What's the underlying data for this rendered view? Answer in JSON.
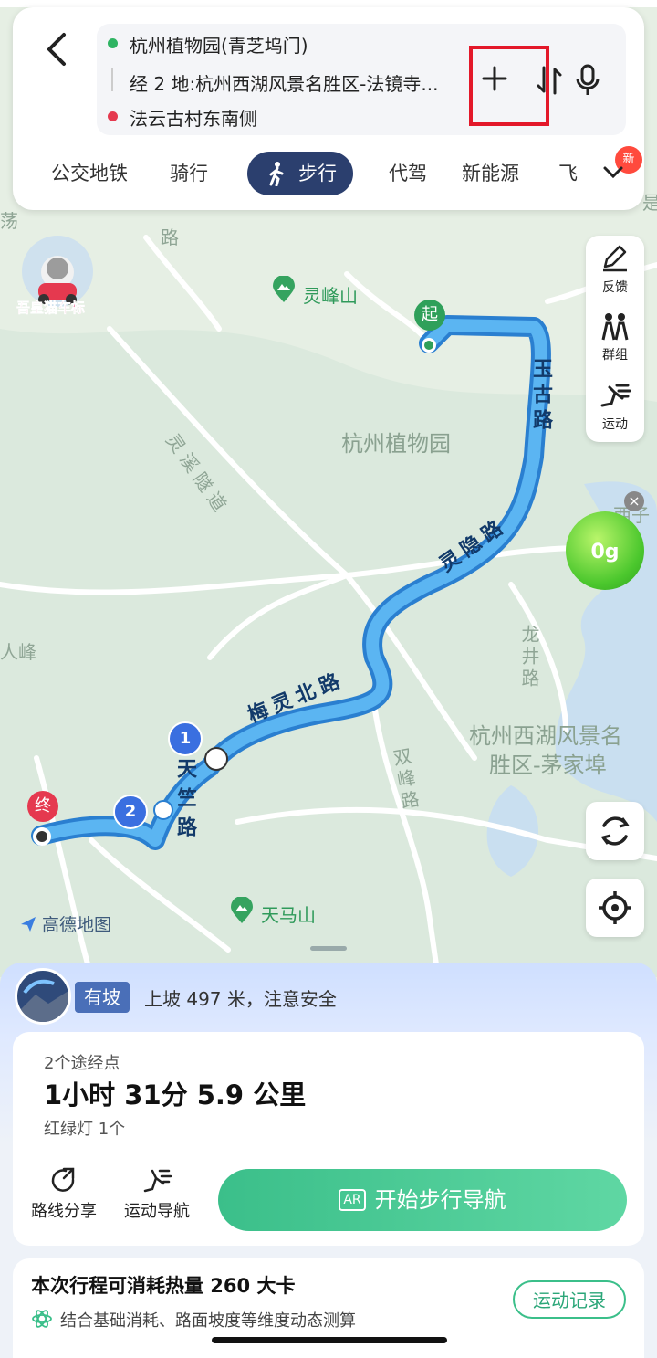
{
  "colors": {
    "accent": "#2b3f6e",
    "route": "#4aa3e8",
    "start": "#2fa05a",
    "end": "#e5394f",
    "go": "#3bbf8a",
    "highlight": "#e3182a"
  },
  "header": {
    "back_icon": "chevron-left-icon",
    "origin": "杭州植物园(青芝坞门)",
    "via": "经 2 地:杭州西湖风景名胜区-法镜寺...",
    "destination": "法云古村东南侧",
    "add_icon": "plus-icon",
    "swap_icon": "swap-icon",
    "mic_icon": "mic-icon"
  },
  "tabs": [
    {
      "label": "公交地铁"
    },
    {
      "label": "骑行"
    },
    {
      "label": "步行",
      "active": true
    },
    {
      "label": "代驾"
    },
    {
      "label": "新能源"
    },
    {
      "label": "飞"
    }
  ],
  "new_badge": "新",
  "tools": [
    {
      "label": "反馈",
      "icon": "pencil-icon"
    },
    {
      "label": "群组",
      "icon": "group-icon"
    },
    {
      "label": "运动",
      "icon": "running-icon"
    }
  ],
  "map": {
    "labels": {
      "lingfeng": "灵峰山",
      "botanical": "杭州植物园",
      "tianma": "天马山",
      "maojiabu_1": "杭州西湖风景名",
      "maojiabu_2": "胜区-茅家埠",
      "lingxi": "灵溪隧道",
      "longjing": "龙井路",
      "shuangfeng": "双峰路",
      "renfeng": "人峰",
      "yugu": "玉古路",
      "lingyin": "灵隐路",
      "meiling": "梅灵北路",
      "tianzhu": "天竺路",
      "xizi": "西子",
      "top_left": "荡",
      "top_right": "是",
      "luroad": "路"
    },
    "start_marker": "起",
    "end_marker": "终",
    "waypoint_1": "1",
    "waypoint_2": "2",
    "green_ball": "0g",
    "avatar_tag": "吾皇猫车标",
    "logo": "高德地图"
  },
  "slope": {
    "badge": "有坡",
    "text": "上坡 497 米，注意安全"
  },
  "summary": {
    "via_count": "2个途经点",
    "duration": "1小时 31分  5.9 公里",
    "lights": "红绿灯 1个"
  },
  "actions": {
    "share": "路线分享",
    "sport_nav": "运动导航",
    "start": "开始步行导航",
    "ar": "AR"
  },
  "calories": {
    "title": "本次行程可消耗热量 260 大卡",
    "subtitle": "结合基础消耗、路面坡度等维度动态测算",
    "record": "运动记录"
  }
}
